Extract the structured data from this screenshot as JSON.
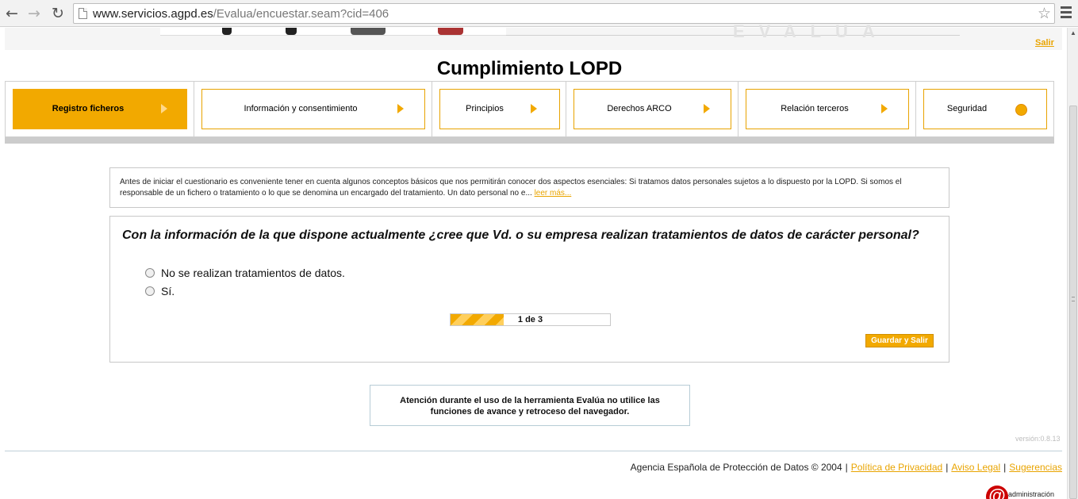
{
  "browser": {
    "url_host": "www.servicios.agpd.es",
    "url_path": "/Evalua/encuestar.seam?cid=406"
  },
  "header": {
    "salir": "Salir",
    "title": "Cumplimiento LOPD"
  },
  "tabs": [
    {
      "label": "Registro ficheros",
      "state": "active",
      "marker": "arrow"
    },
    {
      "label": "Información y consentimiento",
      "state": "inactive",
      "marker": "arrow"
    },
    {
      "label": "Principios",
      "state": "inactive",
      "marker": "arrow"
    },
    {
      "label": "Derechos ARCO",
      "state": "inactive",
      "marker": "arrow"
    },
    {
      "label": "Relación terceros",
      "state": "inactive",
      "marker": "arrow"
    },
    {
      "label": "Seguridad",
      "state": "inactive",
      "marker": "dot"
    }
  ],
  "intro": {
    "text": "Antes de iniciar el cuestionario es conveniente tener en cuenta algunos conceptos básicos que nos permitirán conocer dos aspectos esenciales: Si tratamos datos personales sujetos a lo dispuesto por la LOPD. Si somos el responsable de un fichero o tratamiento o lo que se denomina un encargado del tratamiento. Un dato personal no e...",
    "more_link": "leer más..."
  },
  "question": {
    "text": "Con la información de la que dispone actualmente ¿cree que Vd. o su empresa realizan tratamientos de datos de carácter personal?",
    "options": [
      {
        "label": "No se realizan tratamientos de datos.",
        "checked": false
      },
      {
        "label": "Sí.",
        "checked": false
      }
    ],
    "progress": {
      "current": 1,
      "total": 3,
      "label": "1 de 3"
    },
    "save_button": "Guardar y Salir"
  },
  "warning": {
    "line1": "Atención durante el uso de la herramienta Evalúa no utilice las",
    "line2": "funciones de avance y retroceso del navegador."
  },
  "version": "versión:0.8.13",
  "footer": {
    "copyright": "Agencia Española de Protección de Datos © 2004",
    "links": [
      "Política de Privacidad",
      "Aviso Legal",
      "Sugerencias"
    ],
    "admin_text": "administración"
  },
  "colors": {
    "accent": "#f2a900",
    "border": "#c8c8c8",
    "link": "#e9a400"
  },
  "icons": [
    "back-arrow-icon",
    "forward-arrow-icon",
    "reload-icon",
    "page-icon",
    "star-icon",
    "menu-icon"
  ]
}
